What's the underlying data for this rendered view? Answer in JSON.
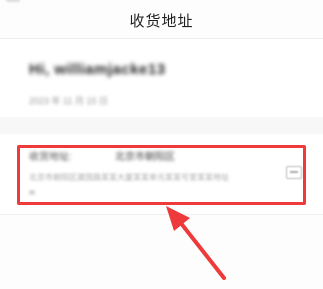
{
  "nav": {
    "title": "收货地址"
  },
  "user": {
    "greeting": "Hi, williamjacke13",
    "sub_info": "2023 年 11 月 15 日"
  },
  "address": {
    "label": "收货地址:",
    "value": "北京市朝阳区",
    "detail": "北京市朝阳区建国路某某大厦某某单元某某号室某某地址",
    "edit_icon": "edit-icon"
  },
  "colors": {
    "highlight": "#ee3a3a",
    "arrow": "#ee3a3a"
  }
}
